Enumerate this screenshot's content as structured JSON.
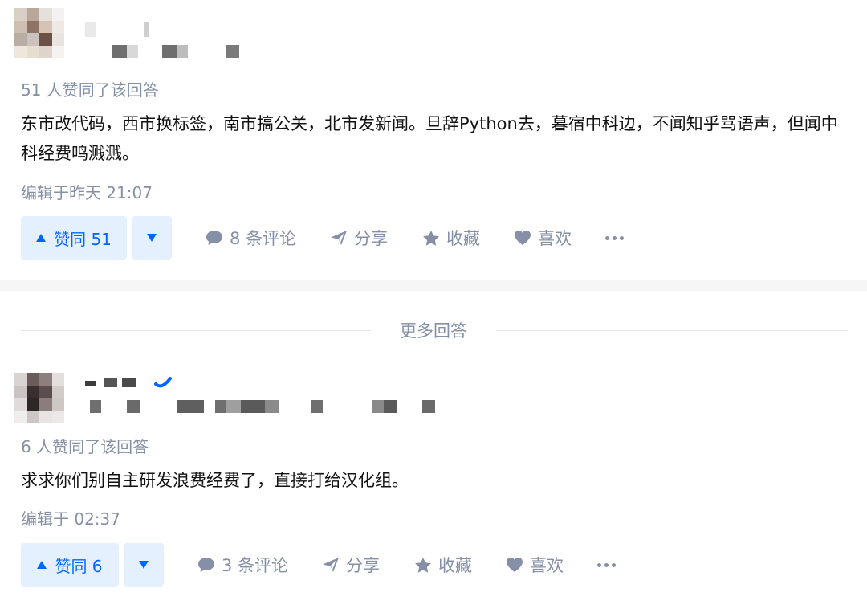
{
  "answers": [
    {
      "vote_summary": "51 人赞同了该回答",
      "content": "东市改代码，西市换标签，南市搞公关，北市发新闻。旦辞Python去，暮宿中科边，不闻知乎骂语声，但闻中科经费鸣溅溅。",
      "edited": "编辑于昨天 21:07",
      "upvote_label": "赞同 51",
      "comments_label": "8 条评论",
      "share_label": "分享",
      "favorite_label": "收藏",
      "like_label": "喜欢"
    },
    {
      "vote_summary": "6 人赞同了该回答",
      "content": "求求你们别自主研发浪费经费了，直接打给汉化组。",
      "edited": "编辑于 02:37",
      "upvote_label": "赞同 6",
      "comments_label": "3 条评论",
      "share_label": "分享",
      "favorite_label": "收藏",
      "like_label": "喜欢"
    }
  ],
  "more_answers_label": "更多回答",
  "icons": {
    "upvote": "triangle-up-icon",
    "downvote": "triangle-down-icon",
    "comment": "comment-bubble-icon",
    "share": "paper-plane-icon",
    "favorite": "star-icon",
    "like": "heart-icon",
    "more": "ellipsis-icon",
    "verified": "verified-check-icon"
  },
  "colors": {
    "accent": "#0066ff",
    "accent_bg": "#e5f0fe",
    "meta_text": "#8590a6",
    "body_text": "#121212",
    "divider": "#f6f6f6"
  }
}
